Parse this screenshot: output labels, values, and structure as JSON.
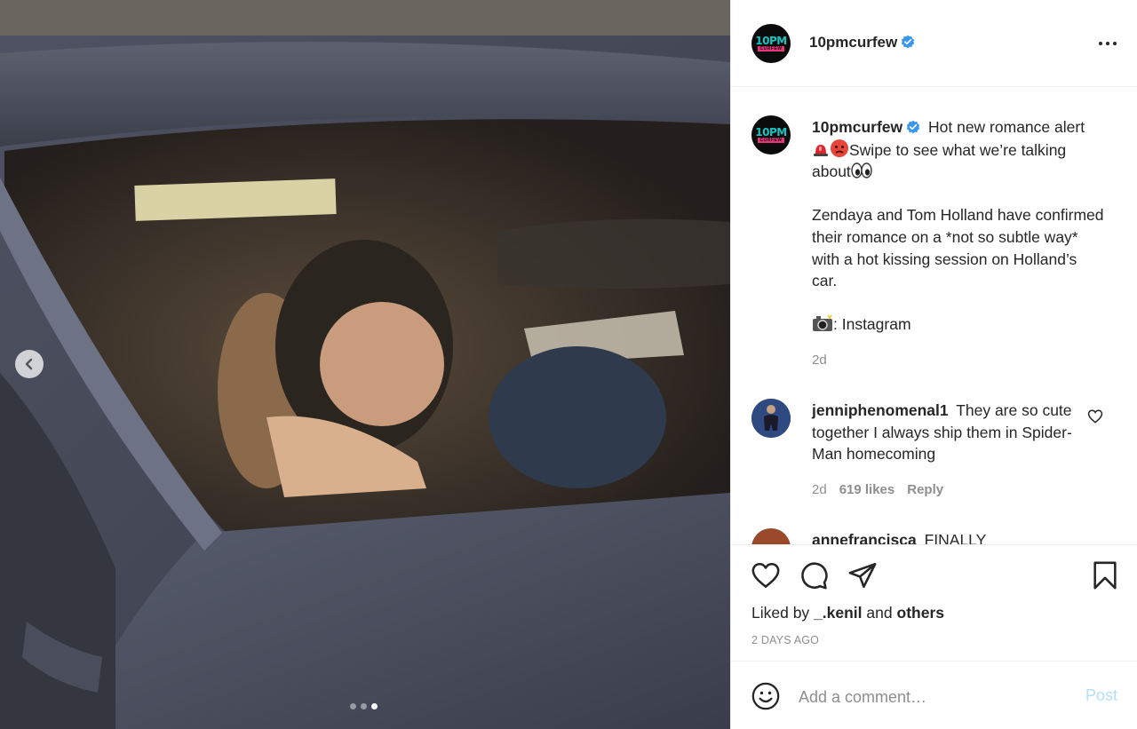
{
  "post": {
    "author": "10pmcurfew",
    "avatar_logo_top": "10PM",
    "avatar_logo_bottom": "CURFEW",
    "verified_icon": "verified-badge-icon",
    "colors": {
      "verified": "#3897f0",
      "post_button_disabled": "#b2dffc",
      "muted": "#8e8e8e",
      "logo_teal": "#13c6c2",
      "logo_pink": "#e8357a"
    }
  },
  "caption": {
    "username": "10pmcurfew",
    "line1_a": "Hot new romance alert",
    "line1_b": "Swipe to see what we’re talking about",
    "paragraph2": "Zendaya and Tom Holland have confirmed their romance on a *not so subtle way* with a hot kissing session on Holland’s car.",
    "paragraph3": ": Instagram",
    "time": "2d"
  },
  "comments": [
    {
      "username": "jenniphenomenal1",
      "text": "They are so cute together I always ship them in Spider-Man homecoming",
      "time": "2d",
      "likes": "619 likes",
      "reply": "Reply"
    },
    {
      "username": "annefrancisca",
      "text": "FINALLY"
    }
  ],
  "actions": {
    "liked_by_prefix": "Liked by",
    "liked_by_user": "_.kenil",
    "liked_by_and": "and",
    "liked_by_others": "others",
    "time_ago": "2 DAYS AGO"
  },
  "composer": {
    "placeholder": "Add a comment…",
    "post_label": "Post"
  },
  "carousel": {
    "total_slides": 3,
    "active_slide": 3
  }
}
